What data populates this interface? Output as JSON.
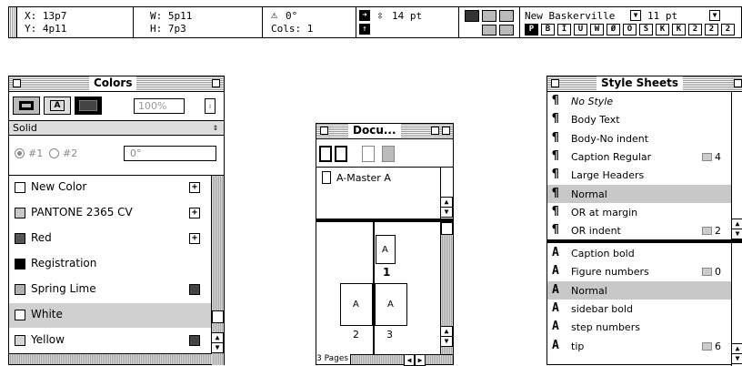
{
  "measurements": {
    "x": "X: 13p7",
    "y": "Y: 4p11",
    "w": "W: 5p11",
    "h": "H: 7p3",
    "angle": "0°",
    "cols": "Cols: 1",
    "leading": "14 pt",
    "font": "New Baskerville",
    "size": "11 pt",
    "style_buttons": [
      "P",
      "B",
      "I",
      "U",
      "W",
      "Ø",
      "O",
      "S",
      "K",
      "K",
      "2",
      "2",
      "2"
    ]
  },
  "colors_palette": {
    "title": "Colors",
    "tint": "100%",
    "fill_type": "Solid",
    "radio1": "#1",
    "radio2": "#2",
    "angle_field": "0°",
    "items": [
      {
        "name": "New Color",
        "swatch": "#ffffff"
      },
      {
        "name": "PANTONE 2365 CV",
        "swatch": "#c8c8c8"
      },
      {
        "name": "Red",
        "swatch": "#555555"
      },
      {
        "name": "Registration",
        "swatch": "#000000"
      },
      {
        "name": "Spring Lime",
        "swatch": "#b0b0b0"
      },
      {
        "name": "White",
        "swatch": "#ffffff"
      },
      {
        "name": "Yellow",
        "swatch": "#d6d6d6"
      }
    ]
  },
  "document_palette": {
    "title": "Docu...",
    "master_label": "A-Master A",
    "page_a": "A",
    "page_1": "1",
    "page_2": "2",
    "page_3": "3",
    "pages_label": "3 Pages"
  },
  "style_sheets": {
    "title": "Style Sheets",
    "paragraph_styles": [
      {
        "name": "No Style",
        "shortcut": ""
      },
      {
        "name": "Body Text",
        "shortcut": ""
      },
      {
        "name": "Body-No indent",
        "shortcut": ""
      },
      {
        "name": "Caption Regular",
        "shortcut": "4"
      },
      {
        "name": "Large Headers",
        "shortcut": ""
      },
      {
        "name": "Normal",
        "shortcut": ""
      },
      {
        "name": "OR at margin",
        "shortcut": ""
      },
      {
        "name": "OR indent",
        "shortcut": "2"
      }
    ],
    "character_styles": [
      {
        "name": "Caption bold",
        "shortcut": ""
      },
      {
        "name": "Figure numbers",
        "shortcut": "0"
      },
      {
        "name": "Normal",
        "shortcut": ""
      },
      {
        "name": "sidebar bold",
        "shortcut": ""
      },
      {
        "name": "step numbers",
        "shortcut": ""
      },
      {
        "name": "tip",
        "shortcut": "6"
      }
    ]
  }
}
